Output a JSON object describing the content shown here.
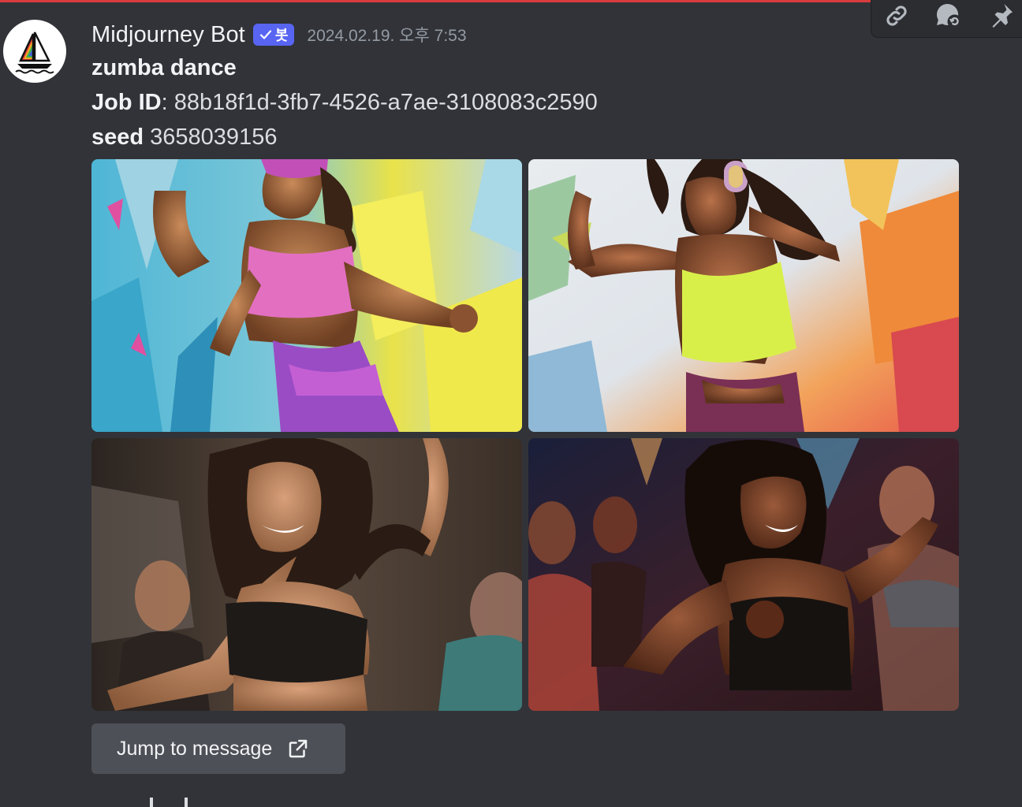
{
  "message": {
    "author": "Midjourney Bot",
    "bot_badge": "봇",
    "timestamp": "2024.02.19. 오후 7:53",
    "prompt": "zumba dance",
    "job_id_label": "Job ID",
    "job_id_value": ": 88b18f1d-3fb7-4526-a7ae-3108083c2590",
    "seed_label": "seed",
    "seed_value": " 3658039156"
  },
  "images": [
    {
      "name": "painted-dancer-pink-top"
    },
    {
      "name": "painted-dancer-yellow-top-headphones"
    },
    {
      "name": "photo-dancer-black-top-curly-hair"
    },
    {
      "name": "photo-dancer-black-top-stage-lights"
    }
  ],
  "jump_button": {
    "label": "Jump to message",
    "icon": "external-link-icon"
  },
  "toolbar": {
    "icons": [
      "link-icon",
      "thread-reply-icon",
      "pin-icon"
    ]
  },
  "colors": {
    "background": "#313338",
    "bot_badge": "#5865f2",
    "button": "#4e5058",
    "accent_line": "#d83c3e"
  }
}
